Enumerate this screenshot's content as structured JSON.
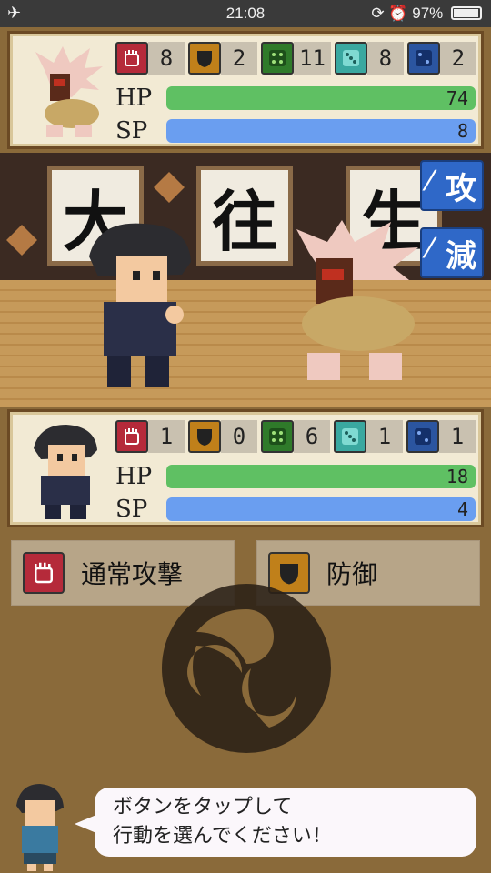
{
  "status_bar": {
    "time": "21:08",
    "battery": "97%"
  },
  "enemy": {
    "stats": {
      "attack": "8",
      "defense": "2",
      "green_dice": "11",
      "cyan_dice": "8",
      "blue_dice": "2"
    },
    "hp_label": "HP",
    "hp": "74",
    "sp_label": "SP",
    "sp": "8"
  },
  "scene": {
    "scrolls": [
      "大",
      "往",
      "生"
    ],
    "side_buttons": [
      "攻",
      "減"
    ]
  },
  "player": {
    "stats": {
      "attack": "1",
      "defense": "0",
      "green_dice": "6",
      "cyan_dice": "1",
      "blue_dice": "1"
    },
    "hp_label": "HP",
    "hp": "18",
    "sp_label": "SP",
    "sp": "4"
  },
  "actions": {
    "attack_label": "通常攻撃",
    "defend_label": "防御"
  },
  "hint": {
    "line1": "ボタンをタップして",
    "line2": "行動を選んでください！"
  },
  "colors": {
    "hp_bar": "#5fc063",
    "sp_bar": "#6a9ef0",
    "attack_icon": "#b52a3a",
    "defense_icon": "#c0801a",
    "side_button": "#2f68c8"
  }
}
